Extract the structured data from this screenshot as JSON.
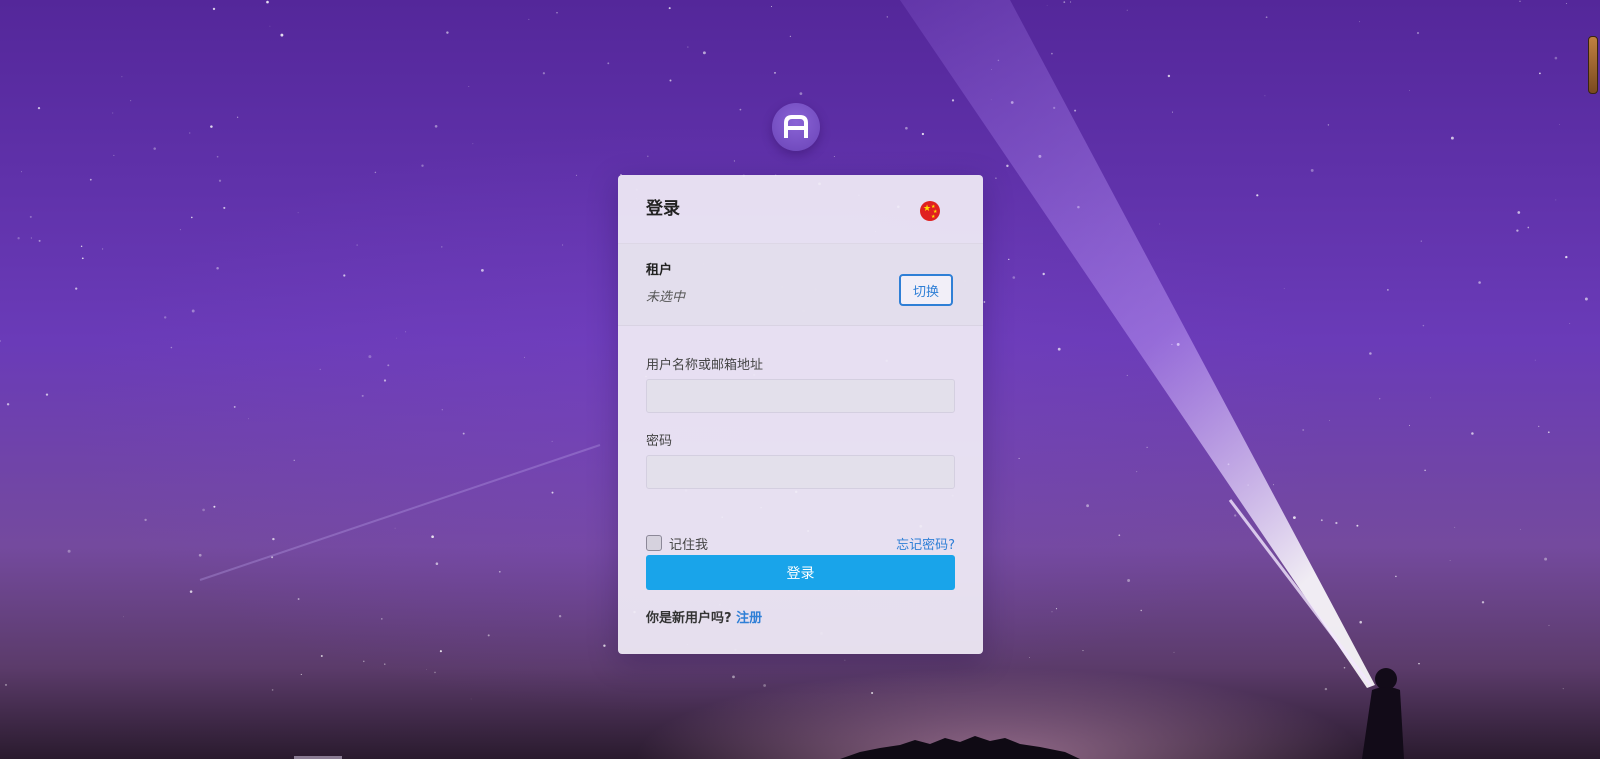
{
  "page": {
    "logo_icon": "a-logo-icon"
  },
  "card": {
    "title": "登录",
    "language_icon": "china-flag-icon",
    "tenant": {
      "label": "租户",
      "value": "未选中",
      "switch_label": "切换"
    },
    "form": {
      "username_label": "用户名称或邮箱地址",
      "username_value": "",
      "password_label": "密码",
      "password_value": "",
      "remember_label": "记住我",
      "remember_checked": false,
      "forgot_label": "忘记密码?",
      "submit_label": "登录"
    },
    "register": {
      "prompt": "你是新用户吗?",
      "link_label": "注册"
    }
  },
  "colors": {
    "accent": "#19a4ea",
    "link": "#2f7fd6",
    "background": "#5b2fa3"
  }
}
